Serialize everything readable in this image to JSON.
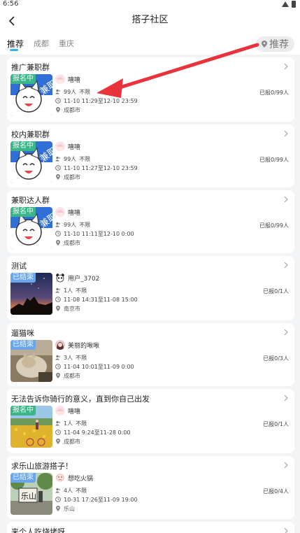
{
  "status": {
    "time": "6:56"
  },
  "nav": {
    "title": "搭子社区"
  },
  "tabs": [
    {
      "label": "推荐",
      "active": true
    },
    {
      "label": "成都",
      "active": false
    },
    {
      "label": "重庆",
      "active": false
    }
  ],
  "recommend_badge": {
    "label": "推荐"
  },
  "colors": {
    "accent": "#2ab8f5",
    "enrolling": "#3bb58a",
    "ended": "#6aa7ea",
    "annotation_arrow": "#e8333d"
  },
  "posts": [
    {
      "title": "推广兼职群",
      "status": "报名中",
      "status_type": "on",
      "image": "cat-parttime-icon",
      "avatar": "anime-girl-avatar",
      "user": "嘻嘻",
      "people": "99人",
      "gender": "不限",
      "time": "11-10 11:29至12-10 23:59",
      "joined": "已报0/99人",
      "location": "成都市"
    },
    {
      "title": "校内兼职群",
      "status": "报名中",
      "status_type": "on",
      "image": "cat-parttime-icon",
      "avatar": "anime-girl-avatar",
      "user": "嘻嘻",
      "people": "99人",
      "gender": "不限",
      "time": "11-10 11:27至12-10 23:59",
      "joined": "已报0/99人",
      "location": "成都市"
    },
    {
      "title": "兼职达人群",
      "status": "报名中",
      "status_type": "on",
      "image": "cat-parttime-icon",
      "avatar": "anime-girl-avatar",
      "user": "嘻嘻",
      "people": "99人",
      "gender": "不限",
      "time": "11-10 11:11至12-10 0:00",
      "joined": "已报0/99人",
      "location": "成都市"
    },
    {
      "title": "测试",
      "status": "已结束",
      "status_type": "done",
      "image": "night-sky-photo",
      "avatar": "panda-avatar",
      "user": "用户_3702",
      "people": "1人",
      "gender": "不限",
      "time": "11-08 14:31至11-08 15:00",
      "joined": "已报0/1人",
      "location": "南京市"
    },
    {
      "title": "遛猫咪",
      "status": "已结束",
      "status_type": "done",
      "image": "cat-photo",
      "avatar": "woman-avatar",
      "user": "美丽的啾啾",
      "people": "3人",
      "gender": "不限",
      "time": "11-04 10:01至11-09 0:00",
      "joined": "已报0/3人",
      "location": "成都市"
    },
    {
      "title": "无法告诉你骑行的意义，直到你自己出发",
      "status": "报名中",
      "status_type": "on",
      "image": "flower-field-photo",
      "avatar": "anime-girl-avatar",
      "user": "嘻嘻",
      "people": "1人",
      "gender": "不限",
      "time": "11-04 9:24至11-28 0:00",
      "joined": "已报0/1人",
      "location": "成都市"
    },
    {
      "title": "求乐山旅游搭子！",
      "status": "已结束",
      "status_type": "done",
      "image": "leshan-sign-photo",
      "avatar": "hotpot-avatar",
      "user": "想吃火锅",
      "people": "4人",
      "gender": "不限",
      "time": "10-31 17:26至11-09 19:00",
      "joined": "已报0/4人",
      "location": "乐山"
    },
    {
      "title": "来个人吃烧烤呀"
    }
  ]
}
